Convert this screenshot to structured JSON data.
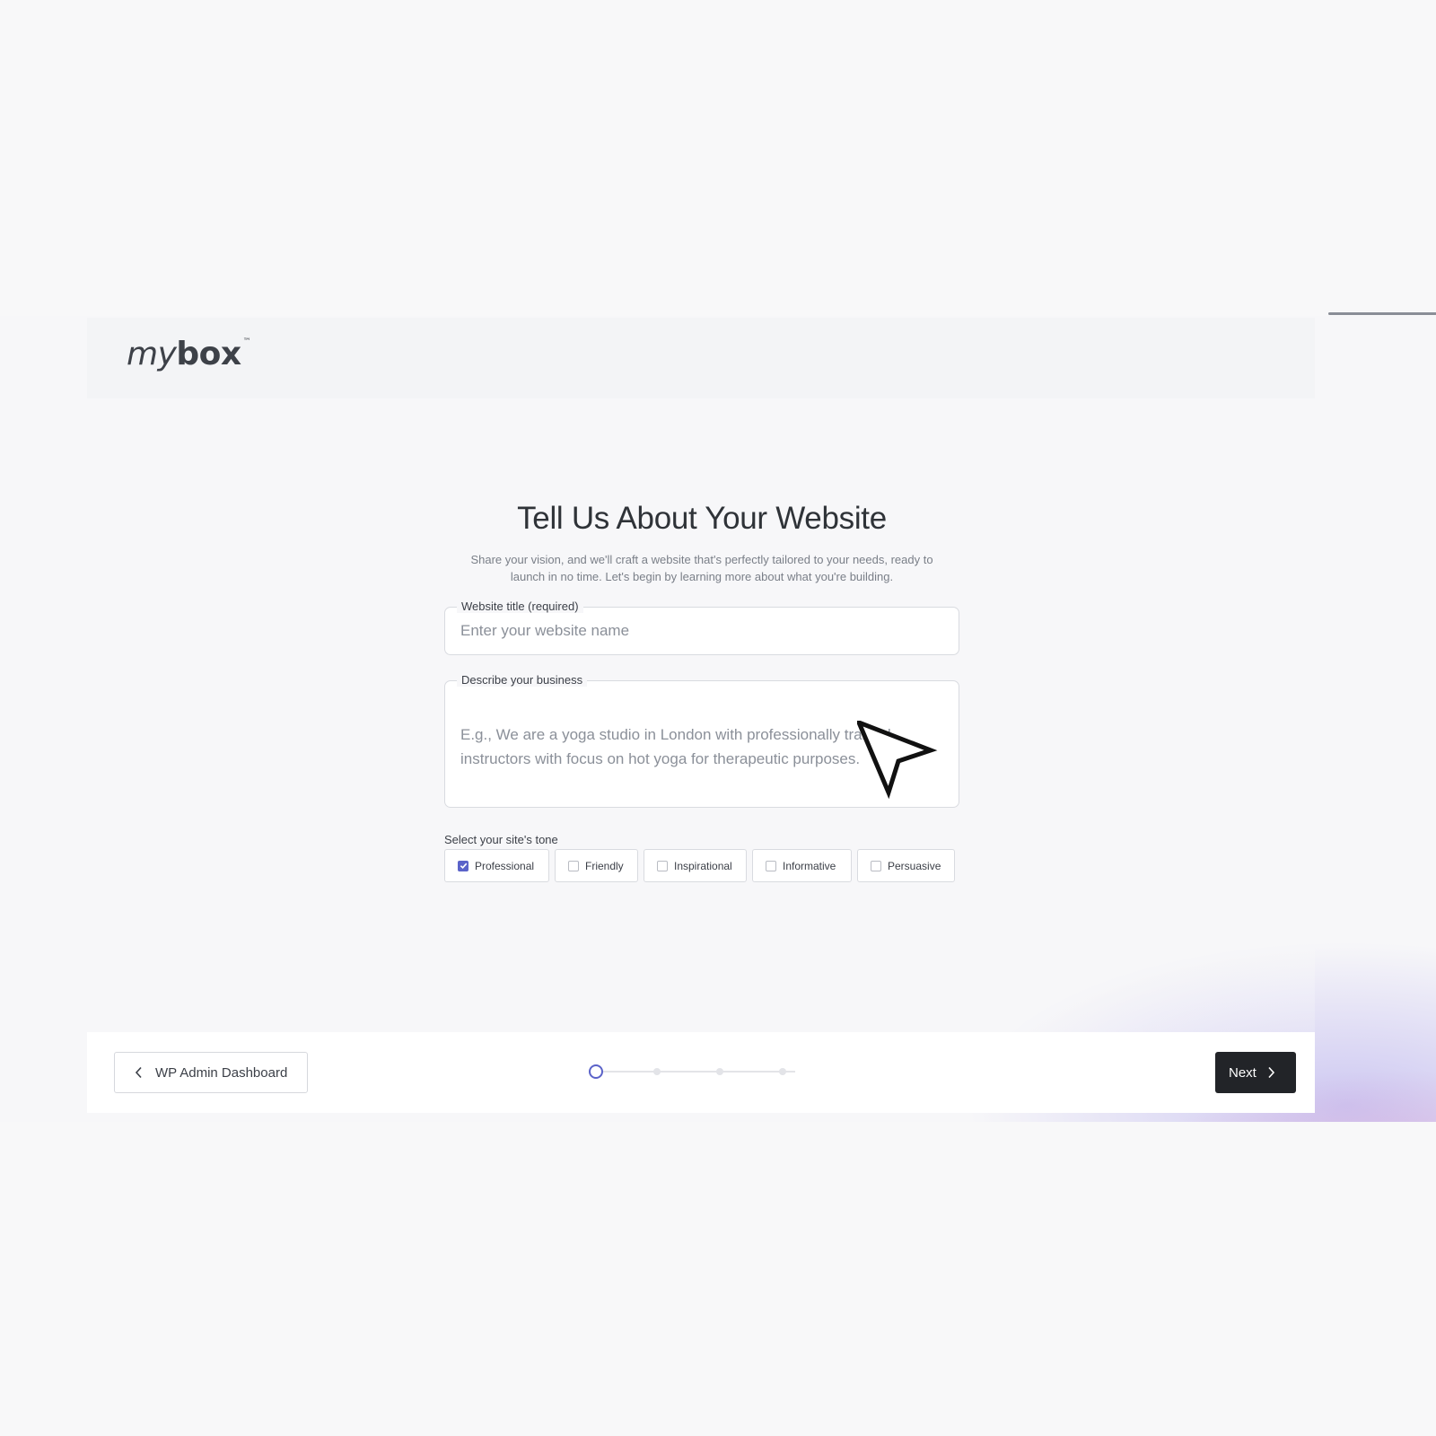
{
  "brand": {
    "logo_light": "my",
    "logo_bold": "box",
    "trademark": "™"
  },
  "page": {
    "title": "Tell Us About Your Website",
    "subtitle_line1": "Share your vision, and we'll craft a website that's perfectly tailored to your needs, ready to",
    "subtitle_line2": "launch in no time. Let's begin by learning more about what you're building."
  },
  "form": {
    "website_title": {
      "label": "Website title (required)",
      "placeholder": "Enter your website name",
      "value": ""
    },
    "description": {
      "label": "Describe your business",
      "placeholder": "E.g., We are a yoga studio in London with professionally trained instructors with focus on hot yoga for therapeutic purposes.",
      "value": ""
    },
    "tone": {
      "label": "Select your site's tone",
      "options": [
        {
          "label": "Professional",
          "checked": true
        },
        {
          "label": "Friendly",
          "checked": false
        },
        {
          "label": "Inspirational",
          "checked": false
        },
        {
          "label": "Informative",
          "checked": false
        },
        {
          "label": "Persuasive",
          "checked": false
        }
      ]
    }
  },
  "footer": {
    "back_label": "WP Admin Dashboard",
    "next_label": "Next",
    "progress": {
      "current_step": 1,
      "total_steps": 4
    }
  },
  "colors": {
    "accent": "#5b63c9",
    "next_button": "#222428",
    "background": "#f8f8f9"
  },
  "icons": {
    "back": "chevron-left-icon",
    "next": "chevron-right-icon",
    "checkbox": "check-icon",
    "pointer": "cursor-arrow-icon"
  }
}
